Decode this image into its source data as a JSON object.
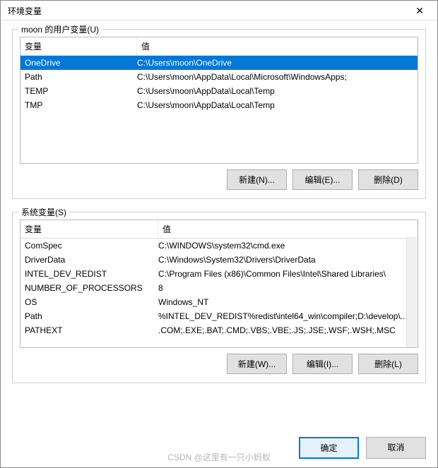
{
  "titlebar": {
    "title": "环境变量"
  },
  "user": {
    "group_label": "moon 的用户变量(U)",
    "col_var": "变量",
    "col_val": "值",
    "rows": [
      {
        "var": "OneDrive",
        "val": "C:\\Users\\moon\\OneDrive"
      },
      {
        "var": "Path",
        "val": "C:\\Users\\moon\\AppData\\Local\\Microsoft\\WindowsApps;"
      },
      {
        "var": "TEMP",
        "val": "C:\\Users\\moon\\AppData\\Local\\Temp"
      },
      {
        "var": "TMP",
        "val": "C:\\Users\\moon\\AppData\\Local\\Temp"
      }
    ],
    "btn_new": "新建(N)...",
    "btn_edit": "编辑(E)...",
    "btn_delete": "删除(D)"
  },
  "system": {
    "group_label": "系统变量(S)",
    "col_var": "变量",
    "col_val": "值",
    "rows": [
      {
        "var": "ComSpec",
        "val": "C:\\WINDOWS\\system32\\cmd.exe"
      },
      {
        "var": "DriverData",
        "val": "C:\\Windows\\System32\\Drivers\\DriverData"
      },
      {
        "var": "INTEL_DEV_REDIST",
        "val": "C:\\Program Files (x86)\\Common Files\\Intel\\Shared Libraries\\"
      },
      {
        "var": "NUMBER_OF_PROCESSORS",
        "val": "8"
      },
      {
        "var": "OS",
        "val": "Windows_NT"
      },
      {
        "var": "Path",
        "val": "%INTEL_DEV_REDIST%redist\\intel64_win\\compiler;D:\\develop\\..."
      },
      {
        "var": "PATHEXT",
        "val": ".COM;.EXE;.BAT;.CMD;.VBS;.VBE;.JS;.JSE;.WSF;.WSH;.MSC"
      }
    ],
    "btn_new": "新建(W)...",
    "btn_edit": "编辑(I)...",
    "btn_delete": "删除(L)"
  },
  "dialog": {
    "ok": "确定",
    "cancel": "取消"
  },
  "watermark": "CSDN @这里有一只小蚂蚁"
}
